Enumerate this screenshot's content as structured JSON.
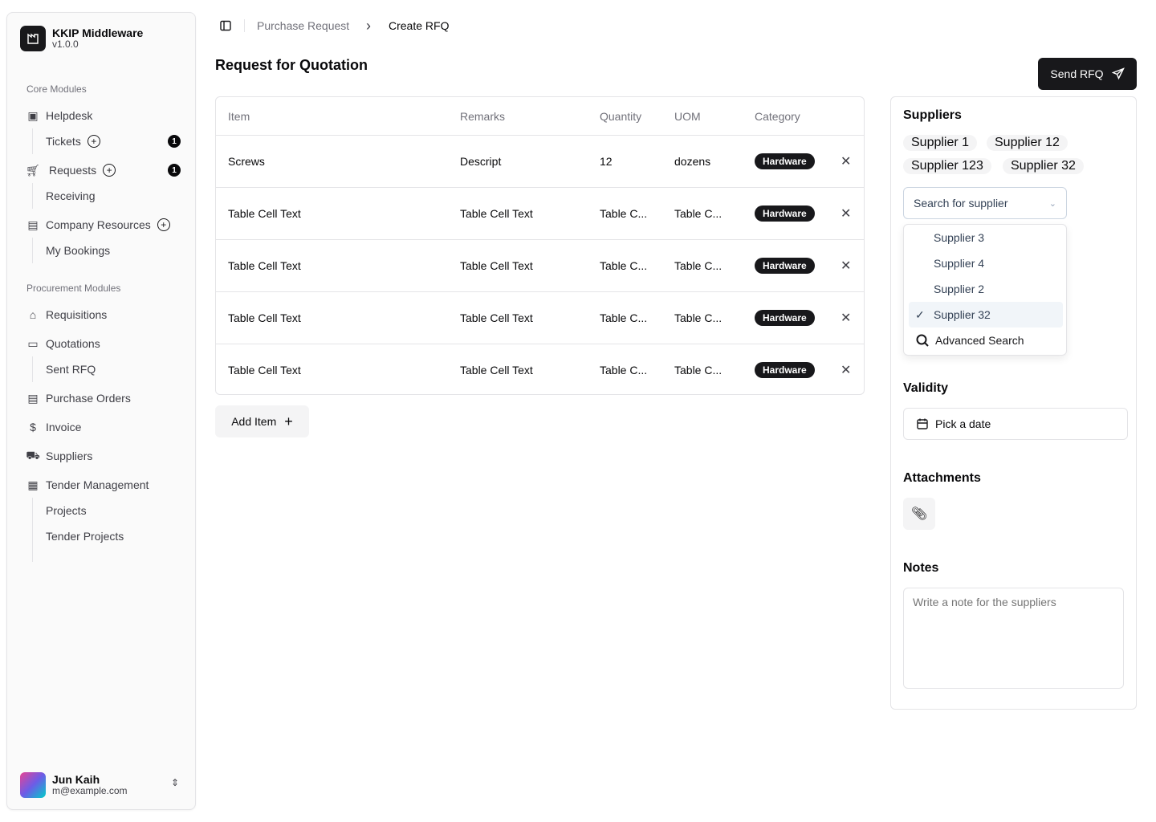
{
  "app": {
    "name": "KKIP Middleware",
    "version": "v1.0.0"
  },
  "sidebar": {
    "core_label": "Core Modules",
    "helpdesk": "Helpdesk",
    "tickets": "Tickets",
    "tickets_count": "1",
    "requests": "Requests",
    "requests_count": "1",
    "receiving": "Receiving",
    "company_resources": "Company Resources",
    "my_bookings": "My Bookings",
    "procurement_label": "Procurement Modules",
    "requisitions": "Requisitions",
    "quotations": "Quotations",
    "sent_rfq": "Sent RFQ",
    "purchase_orders": "Purchase Orders",
    "invoice": "Invoice",
    "suppliers": "Suppliers",
    "tender_management": "Tender Management",
    "projects": "Projects",
    "tender_projects": "Tender Projects"
  },
  "user": {
    "name": "Jun Kaih",
    "email": "m@example.com"
  },
  "breadcrumb": {
    "parent": "Purchase Request",
    "current": "Create RFQ"
  },
  "page": {
    "title": "Request for Quotation",
    "send_label": "Send RFQ",
    "add_item_label": "Add Item"
  },
  "table": {
    "headers": [
      "Item",
      "Remarks",
      "Quantity",
      "UOM",
      "Category"
    ],
    "rows": [
      {
        "item": "Screws",
        "remarks": "Descript",
        "quantity": "12",
        "uom": "dozens",
        "category": "Hardware"
      },
      {
        "item": "Table Cell Text",
        "remarks": "Table Cell Text",
        "quantity": "Table C...",
        "uom": "Table C...",
        "category": "Hardware"
      },
      {
        "item": "Table Cell Text",
        "remarks": "Table Cell Text",
        "quantity": "Table C...",
        "uom": "Table C...",
        "category": "Hardware"
      },
      {
        "item": "Table Cell Text",
        "remarks": "Table Cell Text",
        "quantity": "Table C...",
        "uom": "Table C...",
        "category": "Hardware"
      },
      {
        "item": "Table Cell Text",
        "remarks": "Table Cell Text",
        "quantity": "Table C...",
        "uom": "Table C...",
        "category": "Hardware"
      }
    ]
  },
  "panel": {
    "suppliers_title": "Suppliers",
    "selected": [
      "Supplier 1",
      "Supplier 12",
      "Supplier 123",
      "Supplier 32"
    ],
    "search_placeholder": "Search for supplier",
    "options": [
      "Supplier 3",
      "Supplier 4",
      "Supplier 2",
      "Supplier 32"
    ],
    "checked_option": "Supplier 32",
    "advanced_search": "Advanced Search",
    "validity_title": "Validity",
    "date_placeholder": "Pick a date",
    "attachments_title": "Attachments",
    "notes_title": "Notes",
    "notes_placeholder": "Write a note for the suppliers"
  }
}
